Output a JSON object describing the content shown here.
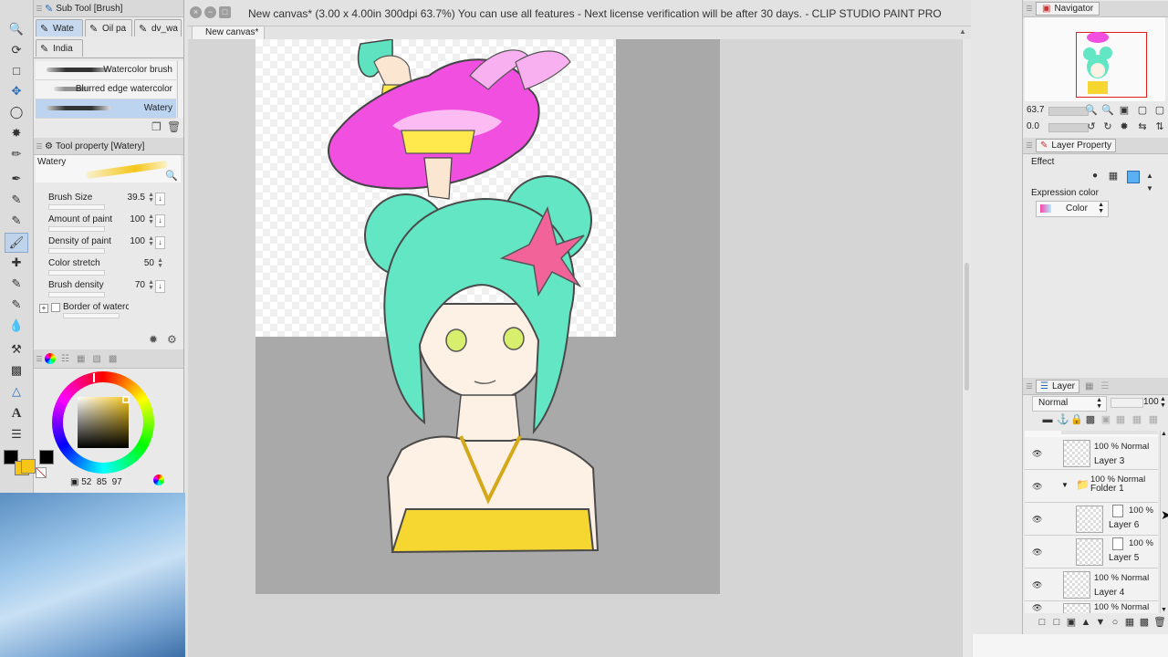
{
  "app": {
    "window_title": "New canvas* (3.00 x 4.00in 300dpi 63.7%)  You can use all features - Next license verification will be after 30 days. - CLIP STUDIO PAINT PRO",
    "doc_tab": "New canvas*"
  },
  "subtool": {
    "title": "Sub Tool [Brush]",
    "tabs": [
      "Wate",
      "Oil pa",
      "dv_wa"
    ],
    "tab2": "India",
    "brushes": [
      "Watercolor brush",
      "Blurred edge watercolor",
      "Watery"
    ]
  },
  "toolprop": {
    "title": "Tool property [Watery]",
    "brush_name": "Watery",
    "props": [
      {
        "label": "Brush Size",
        "value": "39.5"
      },
      {
        "label": "Amount of paint",
        "value": "100"
      },
      {
        "label": "Density of paint",
        "value": "100"
      },
      {
        "label": "Color stretch",
        "value": "50"
      },
      {
        "label": "Brush density",
        "value": "70"
      }
    ],
    "border_label": "Border of watercolor"
  },
  "color": {
    "readout": [
      "52",
      "85",
      "97"
    ],
    "main": "#000000",
    "sub": "#f5c518"
  },
  "navigator": {
    "title": "Navigator",
    "zoom": "63.7",
    "angle": "0.0"
  },
  "layer_property": {
    "title": "Layer Property",
    "effect_label": "Effect",
    "expression_label": "Expression color",
    "expression_value": "Color"
  },
  "layers": {
    "title": "Layer",
    "blend_mode": "Normal",
    "opacity": "100",
    "items": [
      {
        "top": "100 % Normal",
        "name": "Layer 3"
      },
      {
        "top": "100 % Normal",
        "name": "Folder 1"
      },
      {
        "top": "100 %",
        "name": "Layer 6"
      },
      {
        "top": "100 %",
        "name": "Layer 5"
      },
      {
        "top": "100 % Normal",
        "name": "Layer 4"
      },
      {
        "top": "100 % Normal",
        "name": ""
      }
    ]
  }
}
